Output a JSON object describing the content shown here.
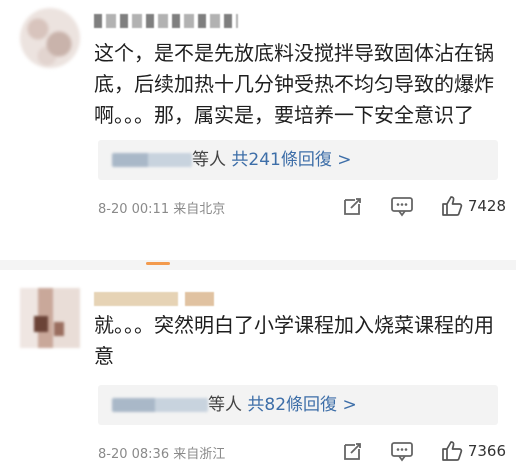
{
  "comments": [
    {
      "text": "这个，是不是先放底料没搅拌导致固体沾在锅底，后续加热十几分钟受热不均匀导致的爆炸啊。。。那，属实是，要培养一下安全意识了",
      "replies_prefix": "等人",
      "replies_link": "共241條回復 >",
      "timestamp": "8-20 00:11",
      "location": "来自北京",
      "likes": "7428"
    },
    {
      "text": "就。。。突然明白了小学课程加入烧菜课程的用意",
      "replies_prefix": "等人",
      "replies_link": "共82條回復 >",
      "timestamp": "8-20 08:36",
      "location": "来自浙江",
      "likes": "7366"
    }
  ],
  "icons": {
    "share": "share-icon",
    "comment": "comment-icon",
    "like": "thumbs-up-icon"
  },
  "colors": {
    "link": "#3d6ea8",
    "accent": "#f39a4d"
  }
}
